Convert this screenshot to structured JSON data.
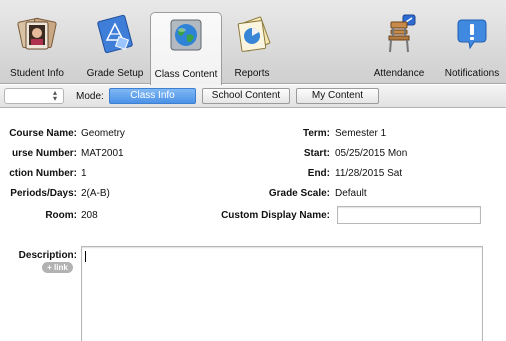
{
  "toolbar": {
    "items": [
      {
        "label": "Student Info",
        "icon": "student-photos-icon"
      },
      {
        "label": "Grade Setup",
        "icon": "blueprint-icon"
      },
      {
        "label": "Class Content",
        "icon": "globe-icon",
        "selected": true
      },
      {
        "label": "Reports",
        "icon": "reports-pie-icon"
      },
      {
        "label": "Attendance",
        "icon": "school-chair-icon"
      },
      {
        "label": "Notifications",
        "icon": "exclamation-icon"
      }
    ]
  },
  "modebar": {
    "mode_label": "Mode:",
    "segments": [
      {
        "label": "Class Info",
        "active": true
      },
      {
        "label": "School Content",
        "active": false
      },
      {
        "label": "My Content",
        "active": false
      }
    ]
  },
  "form": {
    "course_name": {
      "label": "Course Name:",
      "value": "Geometry"
    },
    "course_number": {
      "label": "urse Number:",
      "value": "MAT2001"
    },
    "section_number": {
      "label": "ction Number:",
      "value": "1"
    },
    "periods_days": {
      "label": "Periods/Days:",
      "value": "2(A-B)"
    },
    "room": {
      "label": "Room:",
      "value": "208"
    },
    "term": {
      "label": "Term:",
      "value": "Semester 1"
    },
    "start": {
      "label": "Start:",
      "value": "05/25/2015 Mon"
    },
    "end": {
      "label": "End:",
      "value": "11/28/2015 Sat"
    },
    "grade_scale": {
      "label": "Grade Scale:",
      "value": "Default"
    },
    "custom_display_name": {
      "label": "Custom Display Name:",
      "value": ""
    },
    "description": {
      "label": "Description:",
      "link_label": "+ link",
      "value": ""
    }
  },
  "colors": {
    "accent": "#4b92e6"
  }
}
